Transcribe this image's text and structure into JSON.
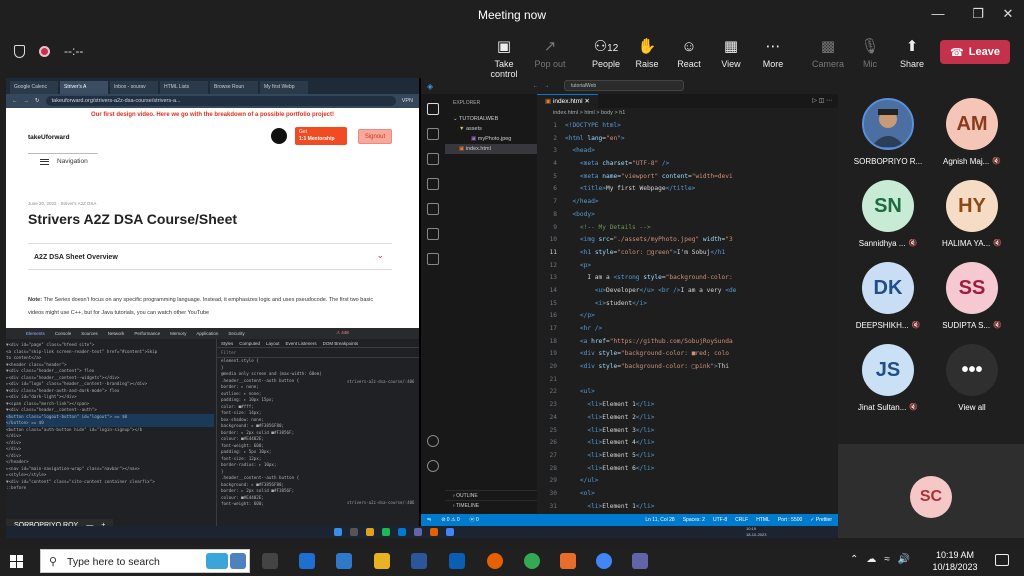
{
  "meeting": {
    "title": "Meeting now",
    "timer": "--:--",
    "people_count": "12",
    "toolbar": {
      "take_control": "Take control",
      "pop_out": "Pop out",
      "people": "People",
      "raise": "Raise",
      "react": "React",
      "view": "View",
      "more": "More",
      "camera": "Camera",
      "mic": "Mic",
      "share": "Share",
      "leave": "Leave"
    }
  },
  "browser": {
    "tabs": [
      "Google Calenc",
      "Striver's A",
      "Inbox - sourav",
      "HTML Lists",
      "Browse Roun",
      "My first Webp"
    ],
    "url": "takeuforward.org/strivers-a2z-dsa-course/strivers-a...",
    "vpn": "VPN",
    "promo": "Our first design video. Here we go with the breakdown of a possible portfolio project!",
    "logo": "takeUforward",
    "mentor_line1": "Get",
    "mentor_line2": "1:1 Mentorship",
    "signout": "Signout",
    "nav": "Navigation",
    "post_meta": "June 20, 2022 · Striver's A2Z DSA",
    "post_title": "Strivers A2Z DSA Course/Sheet",
    "accordion": "A2Z DSA Sheet Overview",
    "note_bold": "Note:",
    "note_text": " The Series doesn't focus on any specific programming language. Instead, it emphasizes logic and uses pseudocode. The first two basic videos might use C++, but for Java tutorials, you can watch other YouTube"
  },
  "devtools": {
    "tabs": [
      "Elements",
      "Console",
      "Sources",
      "Network",
      "Performance",
      "Memory",
      "Application",
      "Security"
    ],
    "issues": "448",
    "dom_lines": [
      "▼<div id=\"page\" class=\"hfeed site\">",
      "  <a class=\"skip-link screen-reader-text\" href=\"#content\">Skip",
      "  to content</a>",
      " ▼<header class=\"header\">",
      "  ▼<div class=\"header__content\"> flex",
      "    ▸<div class=\"header__content--widgets\"></div>",
      "    ▸<div id=\"logo\" class=\"header__content--branding\"></div>",
      "    ▼<div class=\"header-auth-and-dark-mode\"> flex",
      "      ▸<div id=\"dark-light\"></div>",
      "      ▼<span class=\"merch-link\"></span>",
      "      ▼<div class=\"header__content--auth\">",
      "        <button class=\"logout-button\" id=\"logout\"> == $0",
      "        </button> == $0",
      "        <button class=\"auth-button hide\" id=\"login-signup\"></b",
      "        </div>",
      "      </div>",
      "    </div>",
      "  </div>",
      " </header>",
      " ▸<nav id=\"main-navigation-wrap\" class=\"navbar\"></nav>",
      " ▸<style></style>",
      " ▼<div id=\"content\" class=\"site-content container clearfix\">",
      "   ::before"
    ],
    "side_tabs": [
      "Styles",
      "Computed",
      "Layout",
      "Event Listeners",
      "DOM Breakpoints"
    ],
    "filter": "Filter",
    "rules": [
      "element.style {",
      "}",
      "@media only screen and (max-width: 60em)",
      ".header__content--auth button {",
      "  border: ▸ none;",
      "  outline: ▸ none;",
      "  padding: ▸ 10px 15px;",
      "  color: ■#fff;",
      "  font-size: 14px;",
      "  box-shadow: none;",
      "  background: ▸ ■#F3856F80;",
      "  border: ▸ 2px solid ■#F3856F;",
      "  colour: ■#E4402E;",
      "  font-weight: 600;",
      "  padding: ▸ 5px 10px;",
      "  font-size: 12px;",
      "  border-radius: ▸ 10px;",
      "}",
      ".header__content--auth button {",
      "  background: ▸ ■#F3856F80;",
      "  border: ▸ 2px solid ■#F3856F;",
      "  colour: ■#E4402E;",
      "  font-weight: 600;"
    ],
    "rule_source": "strivers-a2z-dsa-course/:406",
    "presenter": "SORBOPRIYO ROY",
    "crumb": "button.logout-button"
  },
  "vscode": {
    "search": "tutorialWeb",
    "explorer_title": "EXPLORER",
    "project": "TUTORIALWEB",
    "folder": "assets",
    "file_image": "myPhoto.jpeg",
    "file_html": "index.html",
    "outline": "OUTLINE",
    "timeline": "TIMELINE",
    "tab": "index.html",
    "breadcrumb": "index.html > html > body > h1",
    "status": {
      "errors": "⊘ 0 ⚠ 0",
      "ports": "ⓦ 0",
      "position": "Ln 11, Col 28",
      "spaces": "Spaces: 2",
      "encoding": "UTF-8",
      "eol": "CRLF",
      "lang": "HTML",
      "port": "Port : 5500",
      "prettier": "✓ Prettier"
    },
    "lines": [
      {
        "n": "1",
        "html": "<span class=\"t\">&lt;!DOCTYPE html&gt;</span>"
      },
      {
        "n": "2",
        "html": "<span class=\"t\">&lt;html</span> <span class=\"a\">lang</span>=<span class=\"s\">\"en\"</span><span class=\"t\">&gt;</span>"
      },
      {
        "n": "3",
        "html": "  <span class=\"t\">&lt;head&gt;</span>"
      },
      {
        "n": "4",
        "html": "    <span class=\"t\">&lt;meta</span> <span class=\"a\">charset</span>=<span class=\"s\">\"UTF-8\"</span> <span class=\"t\">/&gt;</span>"
      },
      {
        "n": "5",
        "html": "    <span class=\"t\">&lt;meta</span> <span class=\"a\">name</span>=<span class=\"s\">\"viewport\"</span> <span class=\"a\">content</span>=<span class=\"s\">\"width=devi</span>"
      },
      {
        "n": "6",
        "html": "    <span class=\"t\">&lt;title&gt;</span>My first Webpage<span class=\"t\">&lt;/title&gt;</span>"
      },
      {
        "n": "7",
        "html": "  <span class=\"t\">&lt;/head&gt;</span>"
      },
      {
        "n": "8",
        "html": "  <span class=\"t\">&lt;body&gt;</span>"
      },
      {
        "n": "9",
        "html": "    <span class=\"c\">&lt;!-- My Details --&gt;</span>"
      },
      {
        "n": "10",
        "html": "    <span class=\"t\">&lt;img</span> <span class=\"a\">src</span>=<span class=\"s\">\"./assets/myPhoto.jpeg\"</span> <span class=\"a\">width</span>=<span class=\"s\">\"3</span>"
      },
      {
        "n": "11",
        "html": "    <span class=\"t\">&lt;h1</span> <span class=\"a\">style</span>=<span class=\"s\">\"color: □green\"</span><span class=\"t\">&gt;</span>I'm Sobuj<span class=\"t\">&lt;/h1</span>"
      },
      {
        "n": "12",
        "html": "    <span class=\"t\">&lt;p&gt;</span>"
      },
      {
        "n": "13",
        "html": "      I am a <span class=\"t\">&lt;strong</span> <span class=\"a\">style</span>=<span class=\"s\">\"background-color:</span>"
      },
      {
        "n": "14",
        "html": "        <span class=\"t\">&lt;u&gt;</span>Developer<span class=\"t\">&lt;/u&gt;</span> <span class=\"t\">&lt;br /&gt;</span>I am a very <span class=\"t\">&lt;de</span>"
      },
      {
        "n": "15",
        "html": "        <span class=\"t\">&lt;i&gt;</span>student<span class=\"t\">&lt;/i&gt;</span>"
      },
      {
        "n": "16",
        "html": "    <span class=\"t\">&lt;/p&gt;</span>"
      },
      {
        "n": "17",
        "html": "    <span class=\"t\">&lt;hr /&gt;</span>"
      },
      {
        "n": "18",
        "html": "    <span class=\"t\">&lt;a</span> <span class=\"a\">href</span>=<span class=\"s\">\"https://github.com/SobujRoySunda</span>"
      },
      {
        "n": "19",
        "html": "    <span class=\"t\">&lt;div</span> <span class=\"a\">style</span>=<span class=\"s\">\"background-color: ■red; colo</span>"
      },
      {
        "n": "20",
        "html": "    <span class=\"t\">&lt;div</span> <span class=\"a\">style</span>=<span class=\"s\">\"background-color: □pink\"</span><span class=\"t\">&gt;</span>Thi"
      },
      {
        "n": "21",
        "html": ""
      },
      {
        "n": "22",
        "html": "    <span class=\"t\">&lt;ul&gt;</span>"
      },
      {
        "n": "23",
        "html": "      <span class=\"t\">&lt;li&gt;</span>Element 1<span class=\"t\">&lt;/li&gt;</span>"
      },
      {
        "n": "24",
        "html": "      <span class=\"t\">&lt;li&gt;</span>Element 2<span class=\"t\">&lt;/li&gt;</span>"
      },
      {
        "n": "25",
        "html": "      <span class=\"t\">&lt;li&gt;</span>Element 3<span class=\"t\">&lt;/li&gt;</span>"
      },
      {
        "n": "26",
        "html": "      <span class=\"t\">&lt;li&gt;</span>Element 4<span class=\"t\">&lt;/li&gt;</span>"
      },
      {
        "n": "27",
        "html": "      <span class=\"t\">&lt;li&gt;</span>Element 5<span class=\"t\">&lt;/li&gt;</span>"
      },
      {
        "n": "28",
        "html": "      <span class=\"t\">&lt;li&gt;</span>Element 6<span class=\"t\">&lt;/li&gt;</span>"
      },
      {
        "n": "29",
        "html": "    <span class=\"t\">&lt;/ul&gt;</span>"
      },
      {
        "n": "30",
        "html": "    <span class=\"t\">&lt;ol&gt;</span>"
      },
      {
        "n": "31",
        "html": "      <span class=\"t\">&lt;li&gt;</span>Element 1<span class=\"t\">&lt;/li&gt;</span>"
      }
    ],
    "current_line": "11"
  },
  "participants": [
    {
      "initials": "",
      "name": "SORBOPRIYO R...",
      "muted": false,
      "bg": "#3b6fb6",
      "fg": "#ffffff",
      "photo": true
    },
    {
      "initials": "AM",
      "name": "Agnish Maj...",
      "muted": true,
      "bg": "#f5c6b8",
      "fg": "#8a3b1e"
    },
    {
      "initials": "SN",
      "name": "Sannidhya ...",
      "muted": true,
      "bg": "#c8ebd6",
      "fg": "#1d6b3e"
    },
    {
      "initials": "HY",
      "name": "HALIMA YA...",
      "muted": true,
      "bg": "#f6dcc4",
      "fg": "#8a4a14"
    },
    {
      "initials": "DK",
      "name": "DEEPSHIKH...",
      "muted": true,
      "bg": "#c9ddf5",
      "fg": "#1f4f8a"
    },
    {
      "initials": "SS",
      "name": "SUDIPTA S...",
      "muted": true,
      "bg": "#f6c8d2",
      "fg": "#9a1f3e"
    },
    {
      "initials": "JS",
      "name": "Jinat Sultan...",
      "muted": true,
      "bg": "#c9e0f5",
      "fg": "#1f4f8a"
    },
    {
      "initials": "•••",
      "name": "View all",
      "muted": false,
      "bg": "#2f2f2f",
      "fg": "#ffffff"
    }
  ],
  "self": {
    "initials": "SC"
  },
  "taskbar": {
    "search": "Type here to search",
    "time": "10:19 AM",
    "date": "10/18/2023",
    "lang": "ENG",
    "inner_time": "10:19",
    "inner_date": "18-10-2023"
  }
}
